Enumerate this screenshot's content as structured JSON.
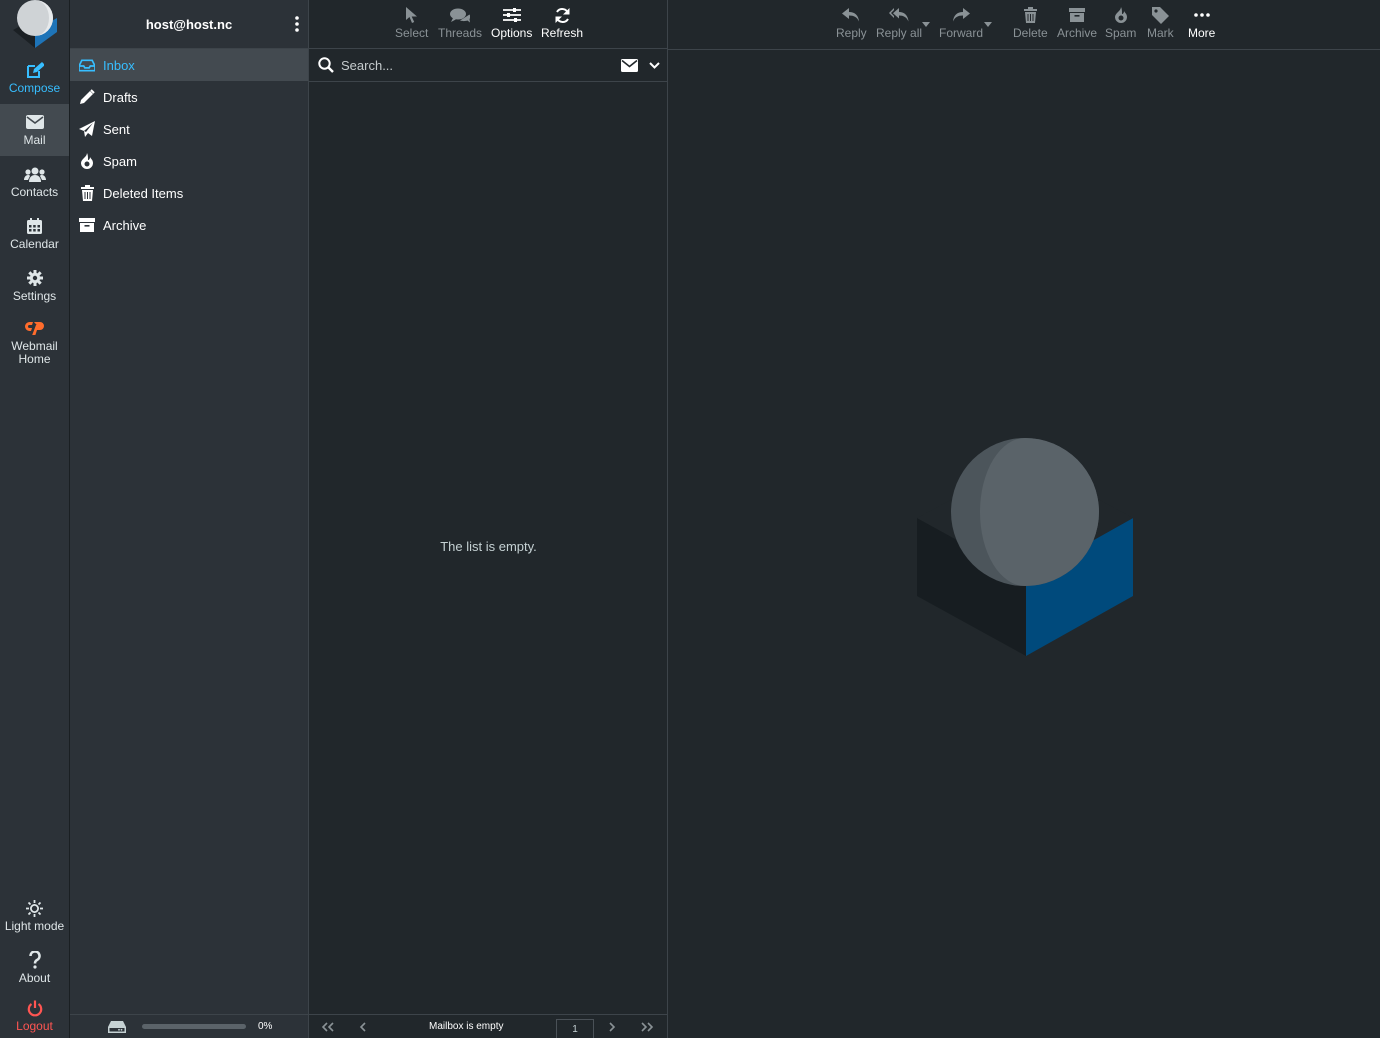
{
  "account": "host@host.nc",
  "taskmenu": {
    "compose": "Compose",
    "mail": "Mail",
    "contacts": "Contacts",
    "calendar": "Calendar",
    "settings": "Settings",
    "webmail_home": "Webmail Home",
    "light_mode": "Light mode",
    "about": "About",
    "logout": "Logout"
  },
  "folders": [
    {
      "label": "Inbox",
      "icon": "inbox-icon",
      "selected": true
    },
    {
      "label": "Drafts",
      "icon": "pencil-icon"
    },
    {
      "label": "Sent",
      "icon": "paper-plane-icon"
    },
    {
      "label": "Spam",
      "icon": "fire-icon"
    },
    {
      "label": "Deleted Items",
      "icon": "trash-icon"
    },
    {
      "label": "Archive",
      "icon": "archive-box-icon"
    }
  ],
  "quota": {
    "percent_label": "0%",
    "fraction": 0
  },
  "list_toolbar": {
    "select": "Select",
    "threads": "Threads",
    "options": "Options",
    "refresh": "Refresh"
  },
  "search": {
    "placeholder": "Search..."
  },
  "message_list": {
    "empty_text": "The list is empty."
  },
  "list_footer": {
    "status": "Mailbox is empty",
    "page": "1"
  },
  "message_toolbar": {
    "reply": "Reply",
    "reply_all": "Reply all",
    "forward": "Forward",
    "delete": "Delete",
    "archive": "Archive",
    "spam": "Spam",
    "mark": "Mark",
    "more": "More"
  },
  "colors": {
    "accent": "#37beff",
    "logout": "#ff5552",
    "webmail_brand": "#ff6c2c",
    "background": "#21272b",
    "panel": "#2c3238"
  }
}
